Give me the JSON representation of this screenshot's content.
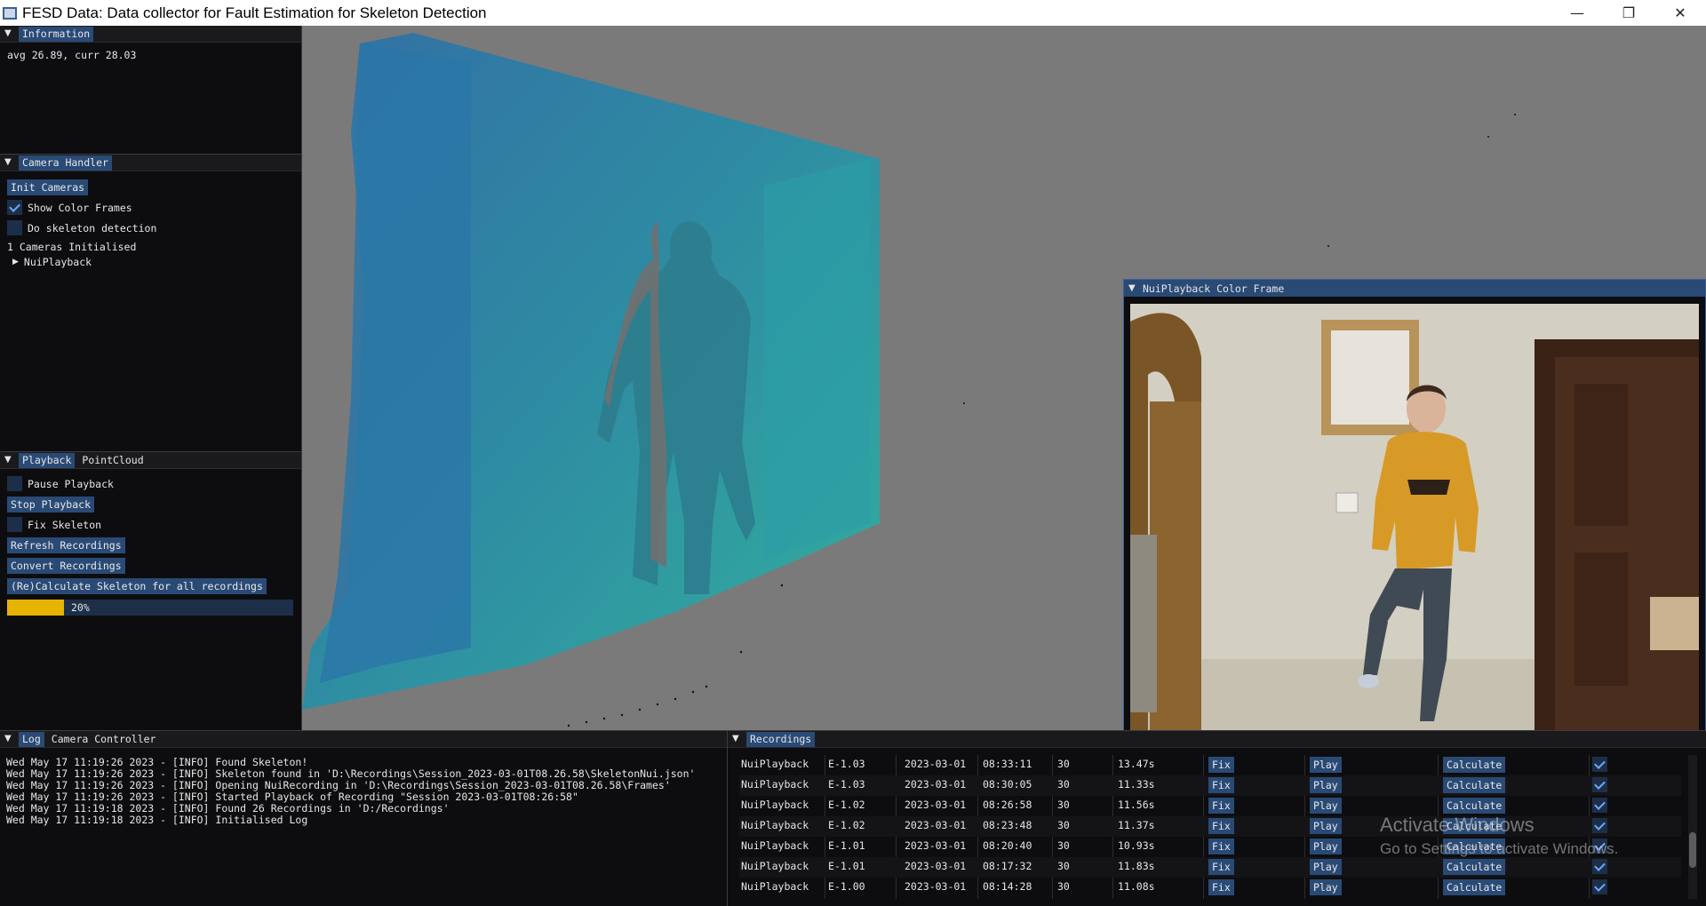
{
  "window": {
    "title": "FESD Data: Data collector for Fault Estimation for Skeleton Detection",
    "minimize": "—",
    "restore": "❐",
    "close": "✕"
  },
  "information": {
    "header": "Information",
    "fps": "avg 26.89, curr 28.03"
  },
  "camera_handler": {
    "header": "Camera Handler",
    "init_button": "Init Cameras",
    "show_color_frames": {
      "label": "Show Color Frames",
      "checked": true
    },
    "do_skeleton": {
      "label": "Do skeleton detection",
      "checked": false
    },
    "status": "1 Cameras Initialised",
    "tree_item": "NuiPlayback"
  },
  "playback": {
    "tabs": [
      "Playback",
      "PointCloud"
    ],
    "pause": {
      "label": "Pause Playback",
      "checked": false
    },
    "stop_button": "Stop Playback",
    "fix_skeleton": {
      "label": "Fix Skeleton",
      "checked": false
    },
    "refresh_button": "Refresh Recordings",
    "convert_button": "Convert Recordings",
    "recalc_button": "(Re)Calculate Skeleton for all recordings",
    "progress": 0.2,
    "progress_text": "20%",
    "progress_color": "#e6b400"
  },
  "color_frame": {
    "header": "NuiPlayback Color Frame"
  },
  "log": {
    "tabs": [
      "Log",
      "Camera Controller"
    ],
    "lines": [
      "Wed May 17 11:19:26 2023 - [INFO] Found Skeleton!",
      "Wed May 17 11:19:26 2023 - [INFO] Skeleton found in 'D:\\Recordings\\Session_2023-03-01T08.26.58\\SkeletonNui.json'",
      "Wed May 17 11:19:26 2023 - [INFO] Opening NuiRecording in 'D:\\Recordings\\Session_2023-03-01T08.26.58\\Frames'",
      "Wed May 17 11:19:26 2023 - [INFO] Started Playback of Recording \"Session 2023-03-01T08:26:58\"",
      "Wed May 17 11:19:18 2023 - [INFO] Found 26 Recordings in 'D:/Recordings'",
      "Wed May 17 11:19:18 2023 - [INFO] Initialised Log"
    ]
  },
  "recordings": {
    "header": "Recordings",
    "rows": [
      {
        "device": "NuiPlayback",
        "exercise": "E-1.03",
        "date": "2023-03-01",
        "time": "08:33:11",
        "fps": "30",
        "duration": "13.47s",
        "fix": "Fix",
        "play": "Play",
        "calc": "Calculate",
        "done": true
      },
      {
        "device": "NuiPlayback",
        "exercise": "E-1.03",
        "date": "2023-03-01",
        "time": "08:30:05",
        "fps": "30",
        "duration": "11.33s",
        "fix": "Fix",
        "play": "Play",
        "calc": "Calculate",
        "done": true
      },
      {
        "device": "NuiPlayback",
        "exercise": "E-1.02",
        "date": "2023-03-01",
        "time": "08:26:58",
        "fps": "30",
        "duration": "11.56s",
        "fix": "Fix",
        "play": "Play",
        "calc": "Calculate",
        "done": true
      },
      {
        "device": "NuiPlayback",
        "exercise": "E-1.02",
        "date": "2023-03-01",
        "time": "08:23:48",
        "fps": "30",
        "duration": "11.37s",
        "fix": "Fix",
        "play": "Play",
        "calc": "Calculate",
        "done": true
      },
      {
        "device": "NuiPlayback",
        "exercise": "E-1.01",
        "date": "2023-03-01",
        "time": "08:20:40",
        "fps": "30",
        "duration": "10.93s",
        "fix": "Fix",
        "play": "Play",
        "calc": "Calculate",
        "done": true
      },
      {
        "device": "NuiPlayback",
        "exercise": "E-1.01",
        "date": "2023-03-01",
        "time": "08:17:32",
        "fps": "30",
        "duration": "11.83s",
        "fix": "Fix",
        "play": "Play",
        "calc": "Calculate",
        "done": true
      },
      {
        "device": "NuiPlayback",
        "exercise": "E-1.00",
        "date": "2023-03-01",
        "time": "08:14:28",
        "fps": "30",
        "duration": "11.08s",
        "fix": "Fix",
        "play": "Play",
        "calc": "Calculate",
        "done": true
      }
    ]
  },
  "watermark": {
    "title": "Activate Windows",
    "subtitle": "Go to Settings to activate Windows."
  }
}
